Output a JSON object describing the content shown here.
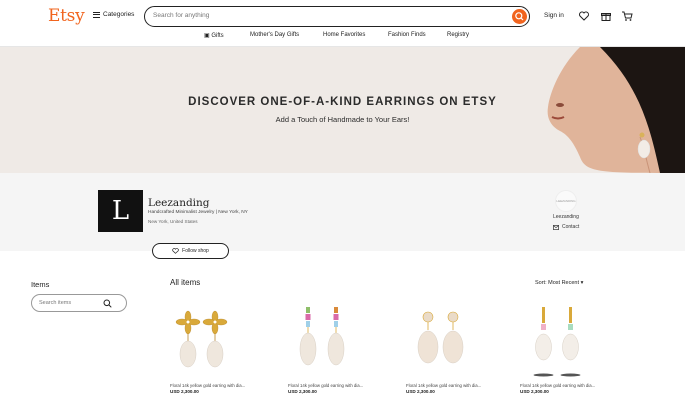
{
  "header": {
    "logo": "Etsy",
    "categories_label": "Categories",
    "search_placeholder": "Search for anything",
    "signin_label": "Sign in",
    "icons": [
      "heart-icon",
      "gift-icon",
      "cart-icon"
    ]
  },
  "nav": {
    "items": [
      "Gifts",
      "Mother's Day Gifts",
      "Home Favorites",
      "Fashion Finds",
      "Registry"
    ]
  },
  "banner": {
    "title": "DISCOVER ONE-OF-A-KIND EARRINGS ON ETSY",
    "subtitle": "Add a Touch of Handmade to Your Ears!"
  },
  "shop": {
    "logo_letter": "L",
    "name": "Leezanding",
    "tagline": "Handcrafted Minimalist Jewelry | New York, NY",
    "location": "New York, United States",
    "owner_avatar_text": "LEEZANDING",
    "owner_name": "Leezanding",
    "contact_label": "Contact",
    "follow_label": "Follow shop"
  },
  "sidebar": {
    "title": "Items",
    "search_placeholder": "Search items"
  },
  "listing": {
    "title": "All items",
    "sort_label": "Sort: Most Recent",
    "cards": [
      {
        "title": "Floral 14k yellow gold earring with dia...",
        "price": "USD 2,300.00"
      },
      {
        "title": "Floral 14k yellow gold earring with dia...",
        "price": "USD 2,300.00"
      },
      {
        "title": "Floral 14k yellow gold earring with dia...",
        "price": "USD 2,300.00"
      },
      {
        "title": "Floral 14k yellow gold earring with dia...",
        "price": "USD 2,300.00"
      }
    ]
  },
  "colors": {
    "brand": "#f1641e",
    "banner_bg": "#efeae6"
  }
}
